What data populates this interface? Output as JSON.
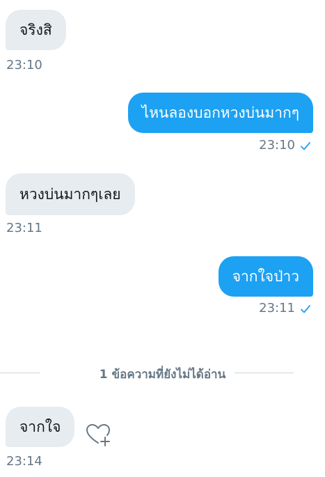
{
  "messages": [
    {
      "text": "จริงสิ",
      "time": "23:10",
      "direction": "in"
    },
    {
      "text": "ไหนลองบอกหวงบ่นมากๆ",
      "time": "23:10",
      "direction": "out",
      "status": "sent"
    },
    {
      "text": "หวงบ่นมากๆเลย",
      "time": "23:11",
      "direction": "in"
    },
    {
      "text": "จากใจป่าว",
      "time": "23:11",
      "direction": "out",
      "status": "sent"
    },
    {
      "text": "จากใจ",
      "time": "23:14",
      "direction": "in"
    }
  ],
  "unread_divider": "1 ข้อความที่ยังไม่ได้อ่าน",
  "icons": {
    "check": "check-icon",
    "add_reaction": "heart-plus-icon"
  },
  "colors": {
    "outgoing_bubble": "#1da1f2",
    "incoming_bubble": "#e6ecf0",
    "timestamp": "#657786",
    "divider_line": "#ccd6dd"
  }
}
